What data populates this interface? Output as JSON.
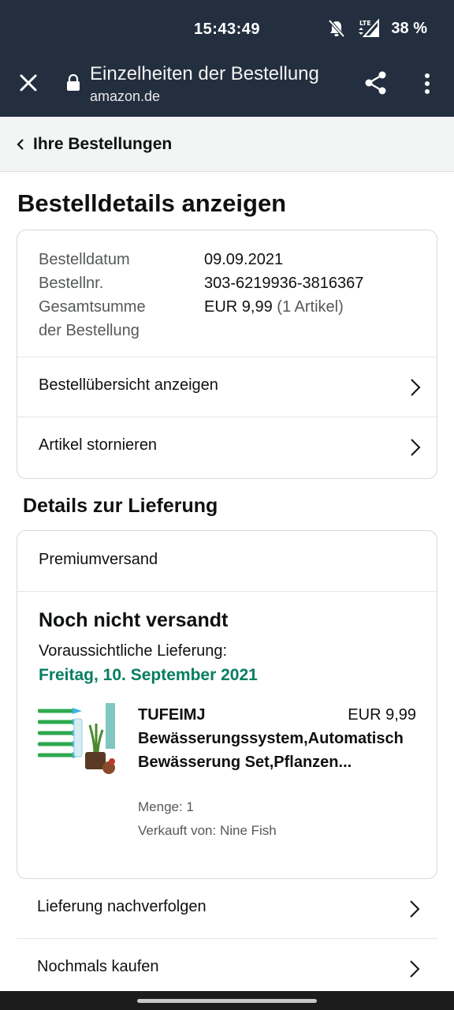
{
  "status_bar": {
    "time": "15:43:49",
    "battery": "38 %",
    "icons": [
      "bell-off-icon",
      "lte-signal-icon"
    ]
  },
  "toolbar": {
    "title": "Einzelheiten der Bestellung",
    "url": "amazon.de",
    "icons": [
      "close-icon",
      "lock-icon",
      "share-icon",
      "more-vert-icon"
    ]
  },
  "breadcrumb": {
    "label": "Ihre Bestellungen"
  },
  "page_title": "Bestelldetails anzeigen",
  "order_info": {
    "date_label": "Bestelldatum",
    "date_value": "09.09.2021",
    "number_label": "Bestellnr.",
    "number_value": "303-6219936-3816367",
    "total_label_line1": "Gesamtsumme",
    "total_label_line2": "der Bestellung",
    "total_amount": "EUR 9,99",
    "total_items": "(1 Artikel)"
  },
  "order_actions": {
    "summary": "Bestellübersicht anzeigen",
    "cancel": "Artikel stornieren"
  },
  "delivery": {
    "section_title": "Details zur Lieferung",
    "shipping_method": "Premiumversand",
    "status": "Noch nicht versandt",
    "eta_label": "Voraussichtliche Lieferung:",
    "eta_date": "Freitag, 10. September 2021",
    "status_color": "#067d62"
  },
  "product": {
    "name": "TUFEIMJ Bewässerungssystem,Automatisch Bewässerung Set,Pflanzen...",
    "price": "EUR 9,99",
    "quantity": "Menge: 1",
    "seller": "Verkauft von: Nine Fish"
  },
  "bottom_actions": {
    "track": "Lieferung nachverfolgen",
    "buy_again": "Nochmals kaufen"
  },
  "colors": {
    "header_bg": "#232f3e",
    "breadcrumb_bg": "#f3f4f4",
    "delivery_date": "#067d62"
  }
}
